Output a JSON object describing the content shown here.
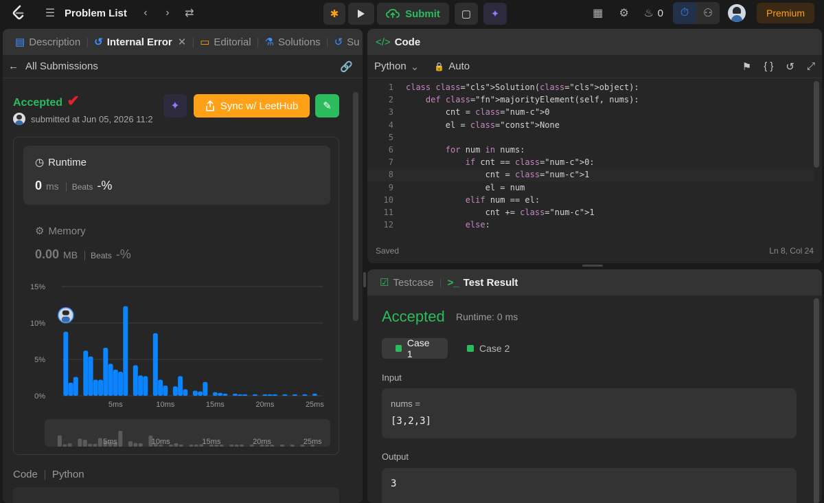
{
  "topbar": {
    "problem_list": "Problem List",
    "submit": "Submit",
    "streak_count": "0",
    "premium": "Premium"
  },
  "left_panel": {
    "tabs": [
      {
        "label": "Description"
      },
      {
        "label": "Internal Error"
      },
      {
        "label": "Editorial"
      },
      {
        "label": "Solutions"
      },
      {
        "label": "Su"
      }
    ],
    "all_submissions": "All Submissions",
    "status": "Accepted",
    "submitted_at": "submitted at Jun 05, 2026 11:2",
    "sync_button": "Sync w/ LeetHub",
    "runtime": {
      "title": "Runtime",
      "value": "0",
      "unit": "ms",
      "beats_label": "Beats",
      "beats_value": "-%"
    },
    "memory": {
      "title": "Memory",
      "value": "0.00",
      "unit": "MB",
      "beats_label": "Beats",
      "beats_value": "-%"
    },
    "code_label": "Code",
    "code_lang": "Python"
  },
  "chart_data": {
    "type": "bar",
    "ylabel": "",
    "xlabel": "",
    "y_ticks": [
      "15%",
      "10%",
      "5%",
      "0%"
    ],
    "ylim": [
      0,
      15
    ],
    "x_ticks": [
      "5ms",
      "10ms",
      "15ms",
      "20ms",
      "25ms"
    ],
    "x_tick_values": [
      5,
      10,
      15,
      20,
      25
    ],
    "x": [
      0,
      0.5,
      1,
      2,
      2.5,
      3,
      3.5,
      4,
      4.5,
      5,
      5.5,
      6,
      7,
      7.5,
      8,
      9,
      9.5,
      10,
      11,
      11.5,
      12,
      13,
      13.5,
      14,
      15,
      15.5,
      16,
      17,
      17.5,
      18,
      19,
      20,
      20.5,
      21,
      22,
      23,
      24,
      25
    ],
    "values": [
      8.8,
      1.8,
      2.6,
      6.2,
      5.4,
      2.2,
      2.2,
      6.6,
      4.4,
      3.6,
      3.3,
      12.3,
      4.2,
      2.8,
      2.7,
      8.6,
      2.2,
      1.4,
      1.3,
      2.7,
      0.9,
      0.7,
      0.6,
      1.9,
      0.5,
      0.4,
      0.3,
      0.3,
      0.2,
      0.2,
      0.2,
      0.2,
      0.2,
      0.2,
      0.2,
      0.2,
      0.2,
      0.3
    ],
    "grid": true
  },
  "editor": {
    "title": "Code",
    "language": "Python",
    "auto": "Auto",
    "status": "Saved",
    "cursor": "Ln 8, Col 24",
    "lines": [
      {
        "n": "1",
        "text": "class Solution(object):"
      },
      {
        "n": "2",
        "text": "    def majorityElement(self, nums):"
      },
      {
        "n": "3",
        "text": "        cnt = 0"
      },
      {
        "n": "4",
        "text": "        el = None"
      },
      {
        "n": "5",
        "text": ""
      },
      {
        "n": "6",
        "text": "        for num in nums:"
      },
      {
        "n": "7",
        "text": "            if cnt == 0:"
      },
      {
        "n": "8",
        "text": "                cnt = 1"
      },
      {
        "n": "9",
        "text": "                el = num"
      },
      {
        "n": "10",
        "text": "            elif num == el:"
      },
      {
        "n": "11",
        "text": "                cnt += 1"
      },
      {
        "n": "12",
        "text": "            else:"
      }
    ]
  },
  "result_panel": {
    "tab_testcase": "Testcase",
    "tab_result": "Test Result",
    "status": "Accepted",
    "runtime": "Runtime: 0 ms",
    "cases": [
      "Case 1",
      "Case 2"
    ],
    "input_label": "Input",
    "input_var": "nums =",
    "input_value": "[3,2,3]",
    "output_label": "Output",
    "output_value": "3"
  },
  "colors": {
    "accent_green": "#2cbb5d",
    "accent_orange": "#ffa116",
    "bar_blue": "#0a84ff"
  }
}
